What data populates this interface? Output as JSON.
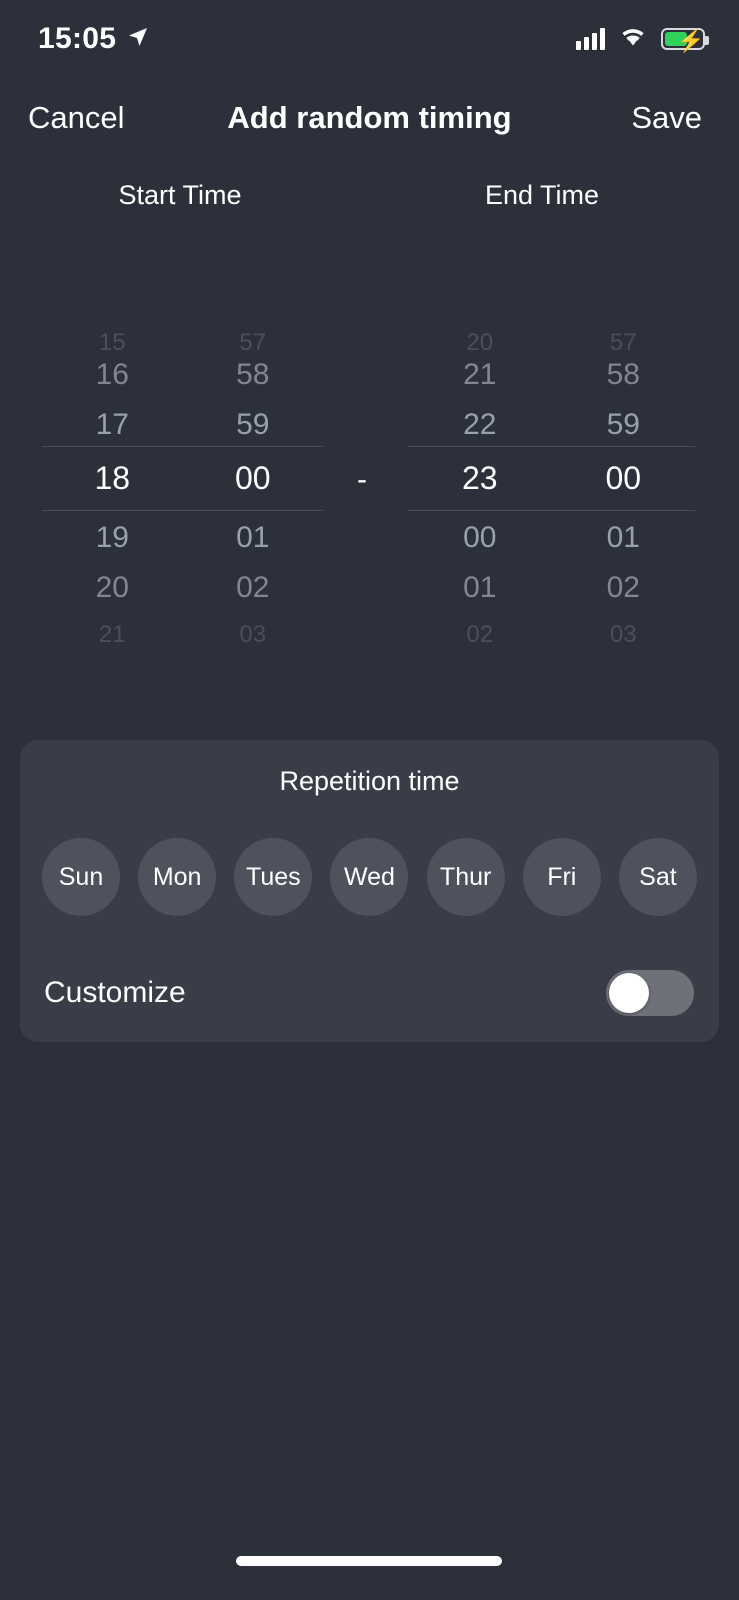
{
  "status_bar": {
    "time": "15:05",
    "location_icon": "location-arrow-icon",
    "signal_icon": "cellular-signal-icon",
    "wifi_icon": "wifi-icon",
    "battery_icon": "battery-charging-icon",
    "battery_charging": true
  },
  "nav": {
    "cancel_label": "Cancel",
    "title": "Add random timing",
    "save_label": "Save"
  },
  "pickers": {
    "start_label": "Start Time",
    "end_label": "End Time",
    "separator": "-",
    "start": {
      "hours": {
        "above": [
          "15",
          "16",
          "17"
        ],
        "selected": "18",
        "below": [
          "19",
          "20",
          "21"
        ]
      },
      "minutes": {
        "above": [
          "57",
          "58",
          "59"
        ],
        "selected": "00",
        "below": [
          "01",
          "02",
          "03"
        ]
      }
    },
    "end": {
      "hours": {
        "above": [
          "20",
          "21",
          "22"
        ],
        "selected": "23",
        "below": [
          "00",
          "01",
          "02"
        ]
      },
      "minutes": {
        "above": [
          "57",
          "58",
          "59"
        ],
        "selected": "00",
        "below": [
          "01",
          "02",
          "03"
        ]
      }
    }
  },
  "repetition": {
    "title": "Repetition time",
    "days": [
      {
        "label": "Sun",
        "selected": false
      },
      {
        "label": "Mon",
        "selected": false
      },
      {
        "label": "Tues",
        "selected": false
      },
      {
        "label": "Wed",
        "selected": false
      },
      {
        "label": "Thur",
        "selected": false
      },
      {
        "label": "Fri",
        "selected": false
      },
      {
        "label": "Sat",
        "selected": false
      }
    ],
    "customize_label": "Customize",
    "customize_on": false
  },
  "colors": {
    "page_background": "#2b303a",
    "card_background": "#383d48",
    "day_chip": "#4d525d",
    "selected_text": "#ffffff",
    "dim_text": "#868b94",
    "toggle_track_off": "#6e7178",
    "toggle_knob": "#ffffff",
    "battery_green": "#30d158"
  },
  "home_indicator": "home-indicator"
}
